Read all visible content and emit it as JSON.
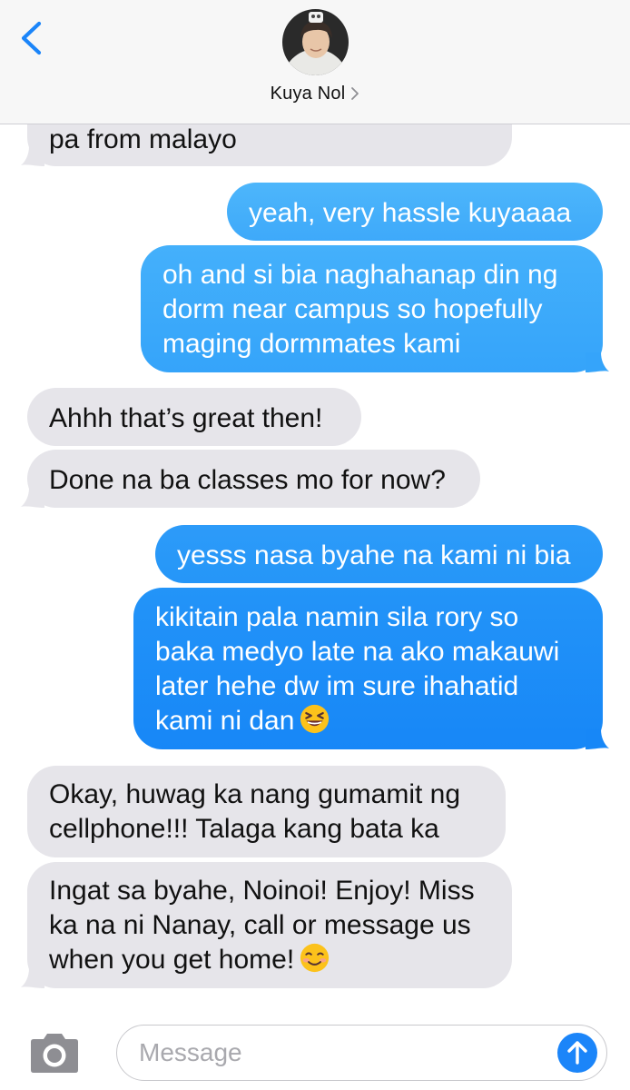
{
  "header": {
    "contact_name": "Kuya Nol",
    "back_icon": "chevron-left-icon",
    "detail_icon": "chevron-right-icon"
  },
  "colors": {
    "received_bubble": "#e6e5ea",
    "sent_bubble_top": "#4fb8fb",
    "sent_bubble_bottom": "#1787f7",
    "accent": "#1b85f9"
  },
  "messages": [
    {
      "from": "contact",
      "lines": [
        "pa from malayo"
      ]
    },
    {
      "from": "me",
      "lines": [
        "yeah, very hassle kuyaaaa"
      ]
    },
    {
      "from": "me",
      "lines": [
        "oh and si bia naghahanap din ng",
        "dorm near campus so hopefully",
        "maging dormmates kami"
      ]
    },
    {
      "from": "contact",
      "lines": [
        "Ahhh that’s great then!"
      ]
    },
    {
      "from": "contact",
      "lines": [
        "Done na ba classes mo for now?"
      ]
    },
    {
      "from": "me",
      "lines": [
        "yesss nasa byahe na kami ni bia"
      ]
    },
    {
      "from": "me",
      "lines": [
        "kikitain pala namin sila rory so",
        "baka medyo late na ako makauwi",
        "later hehe dw im sure ihahatid",
        "kami ni dan"
      ],
      "emoji": "grinning-squinting-face"
    },
    {
      "from": "contact",
      "lines": [
        "Okay, huwag ka nang gumamit ng",
        "cellphone!!! Talaga kang bata ka"
      ]
    },
    {
      "from": "contact",
      "lines": [
        "Ingat sa byahe, Noinoi! Enjoy! Miss",
        "ka na ni Nanay, call or message us",
        "when you get home!"
      ],
      "emoji": "smiling-face"
    }
  ],
  "composer": {
    "placeholder": "Message",
    "camera_icon": "camera-icon",
    "send_icon": "arrow-up-icon"
  }
}
